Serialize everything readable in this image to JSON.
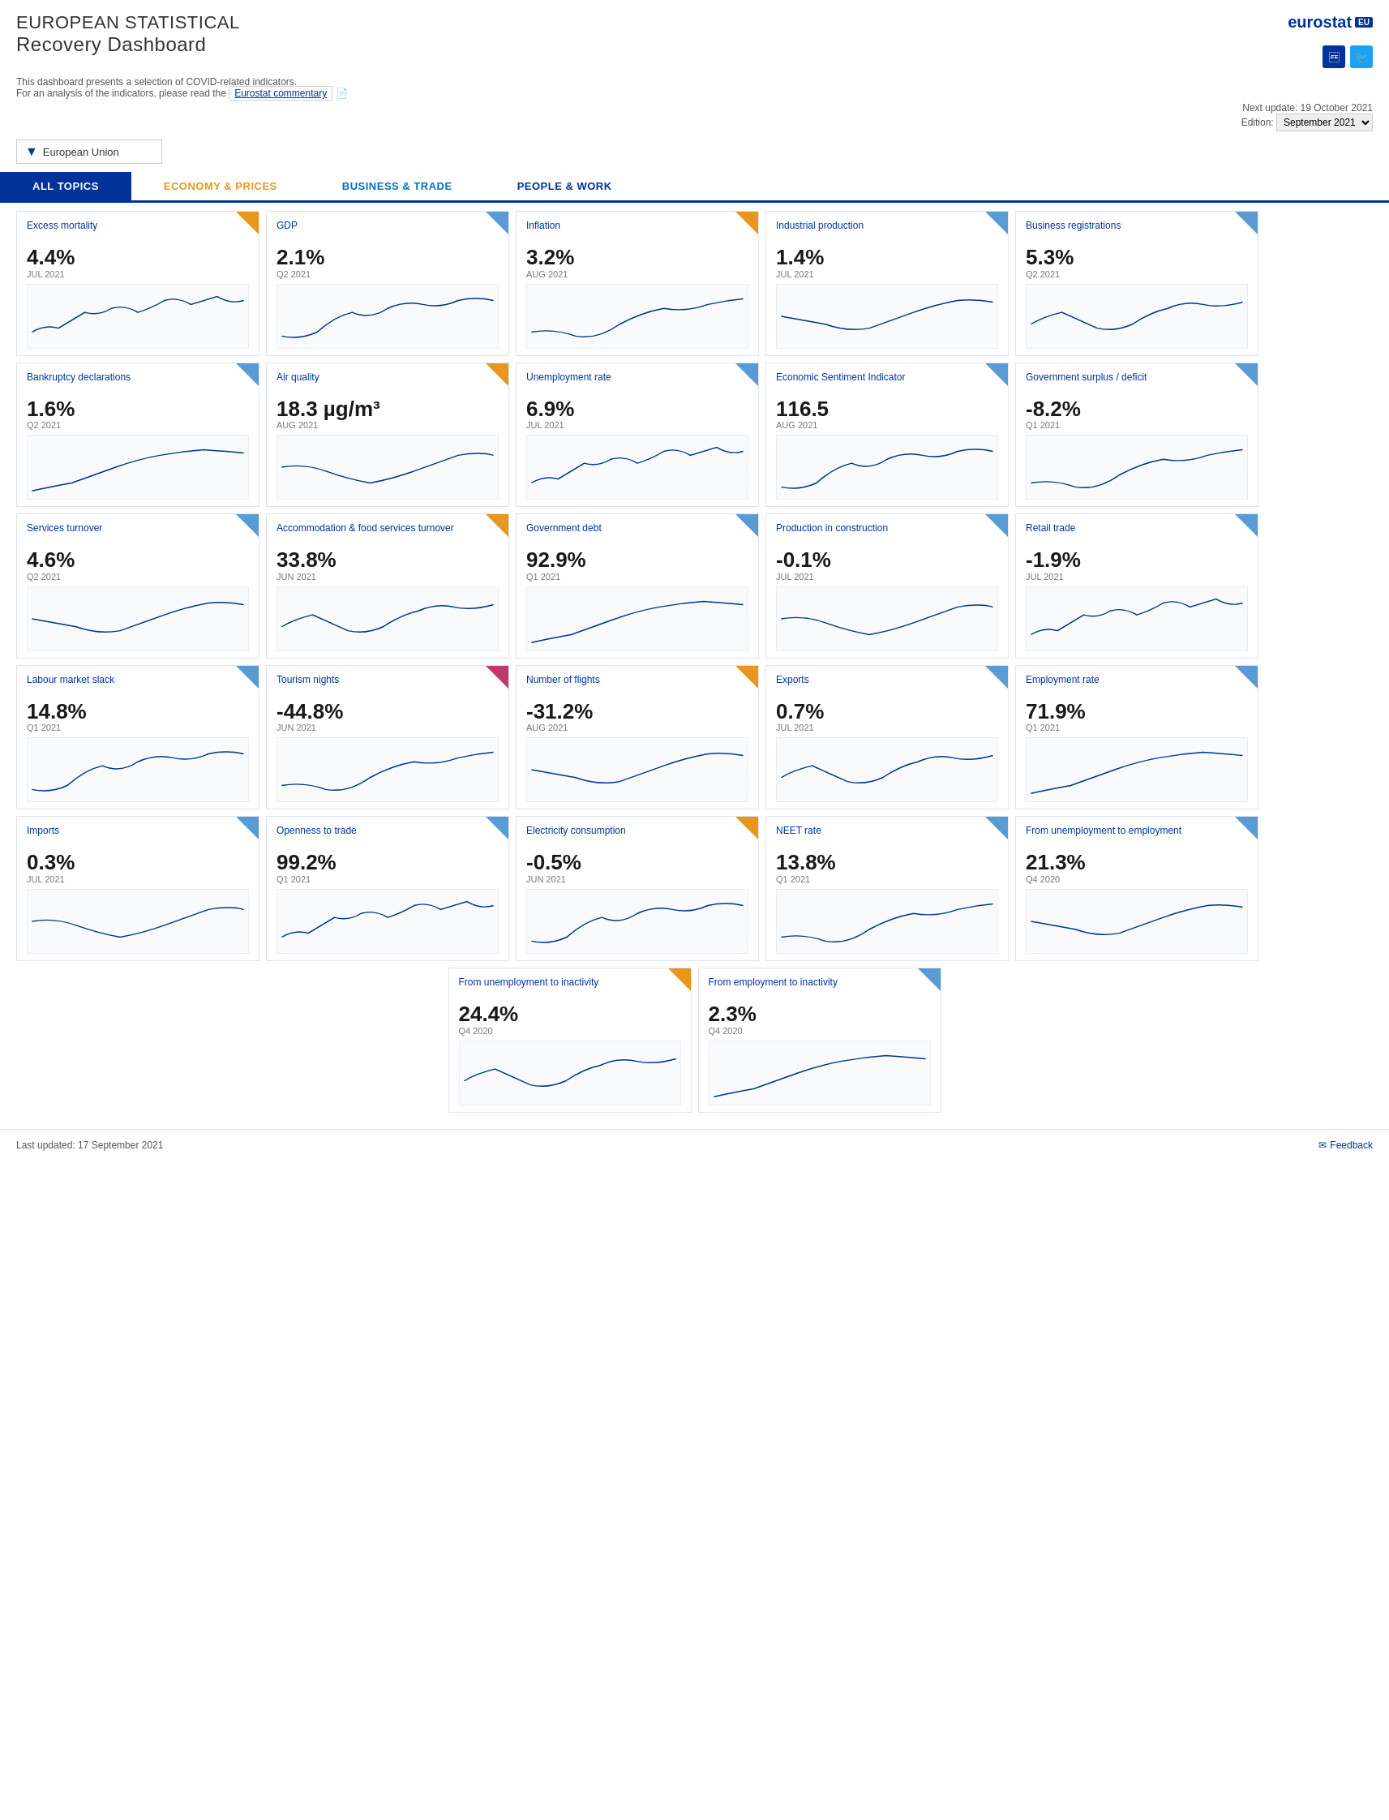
{
  "header": {
    "site_title": "EUROPEAN STATISTICAL",
    "site_subtitle": "Recovery Dashboard",
    "eurostat_label": "eurostat",
    "description_line1": "This dashboard presents a selection of COVID-related indicators.",
    "description_line2": "For an analysis of the indicators, please read the",
    "commentary_link": "Eurostat commentary",
    "next_update_label": "Next update: 19 October 2021",
    "edition_label": "Edition:",
    "edition_value": "September 2021",
    "region_label": "European Union",
    "facebook_icon": "f",
    "twitter_icon": "t"
  },
  "nav": {
    "tabs": [
      {
        "id": "all",
        "label": "ALL TOPICS",
        "active": true
      },
      {
        "id": "economy",
        "label": "ECONOMY & PRICES",
        "active": false
      },
      {
        "id": "business",
        "label": "BUSINESS & TRADE",
        "active": false
      },
      {
        "id": "people",
        "label": "PEOPLE & WORK",
        "active": false
      }
    ]
  },
  "footer": {
    "last_updated": "Last updated: 17 September 2021",
    "feedback": "Feedback"
  },
  "cards": [
    {
      "row": 0,
      "items": [
        {
          "id": "excess-mortality",
          "title": "Excess mortality",
          "value": "4.4%",
          "period": "JUL 2021",
          "corner": "orange",
          "chart_type": "line"
        },
        {
          "id": "gdp",
          "title": "GDP",
          "value": "2.1%",
          "period": "Q2 2021",
          "corner": "blue",
          "chart_type": "line"
        },
        {
          "id": "inflation",
          "title": "Inflation",
          "value": "3.2%",
          "period": "AUG 2021",
          "corner": "orange",
          "chart_type": "line"
        },
        {
          "id": "industrial-production",
          "title": "Industrial production",
          "value": "1.4%",
          "period": "JUL 2021",
          "corner": "blue",
          "chart_type": "line"
        },
        {
          "id": "business-registrations",
          "title": "Business registrations",
          "value": "5.3%",
          "period": "Q2 2021",
          "corner": "blue",
          "chart_type": "line"
        }
      ]
    },
    {
      "row": 1,
      "items": [
        {
          "id": "bankruptcy-declarations",
          "title": "Bankruptcy declarations",
          "value": "1.6%",
          "period": "Q2 2021",
          "corner": "blue",
          "chart_type": "line"
        },
        {
          "id": "air-quality",
          "title": "Air quality",
          "value": "18.3 µg/m³",
          "period": "AUG 2021",
          "corner": "orange",
          "chart_type": "line"
        },
        {
          "id": "unemployment-rate",
          "title": "Unemployment rate",
          "value": "6.9%",
          "period": "JUL 2021",
          "corner": "blue",
          "chart_type": "line"
        },
        {
          "id": "economic-sentiment",
          "title": "Economic Sentiment Indicator",
          "value": "116.5",
          "period": "AUG 2021",
          "corner": "blue",
          "chart_type": "line"
        },
        {
          "id": "government-surplus",
          "title": "Government surplus / deficit",
          "value": "-8.2%",
          "period": "Q1 2021",
          "corner": "blue",
          "chart_type": "line"
        }
      ]
    },
    {
      "row": 2,
      "items": [
        {
          "id": "services-turnover",
          "title": "Services turnover",
          "value": "4.6%",
          "period": "Q2 2021",
          "corner": "blue",
          "chart_type": "line"
        },
        {
          "id": "accommodation-food",
          "title": "Accommodation & food services turnover",
          "value": "33.8%",
          "period": "JUN 2021",
          "corner": "orange",
          "chart_type": "line"
        },
        {
          "id": "government-debt",
          "title": "Government debt",
          "value": "92.9%",
          "period": "Q1 2021",
          "corner": "blue",
          "chart_type": "line"
        },
        {
          "id": "production-construction",
          "title": "Production in construction",
          "value": "-0.1%",
          "period": "JUL 2021",
          "corner": "blue",
          "chart_type": "line"
        },
        {
          "id": "retail-trade",
          "title": "Retail trade",
          "value": "-1.9%",
          "period": "JUL 2021",
          "corner": "blue",
          "chart_type": "line"
        }
      ]
    },
    {
      "row": 3,
      "items": [
        {
          "id": "labour-market-slack",
          "title": "Labour market slack",
          "value": "14.8%",
          "period": "Q1 2021",
          "corner": "blue",
          "chart_type": "line"
        },
        {
          "id": "tourism-nights",
          "title": "Tourism nights",
          "value": "-44.8%",
          "period": "JUN 2021",
          "corner": "pink",
          "chart_type": "line"
        },
        {
          "id": "number-of-flights",
          "title": "Number of flights",
          "value": "-31.2%",
          "period": "AUG 2021",
          "corner": "orange",
          "chart_type": "line"
        },
        {
          "id": "exports",
          "title": "Exports",
          "value": "0.7%",
          "period": "JUL 2021",
          "corner": "blue",
          "chart_type": "line"
        },
        {
          "id": "employment-rate",
          "title": "Employment rate",
          "value": "71.9%",
          "period": "Q1 2021",
          "corner": "blue",
          "chart_type": "line"
        }
      ]
    },
    {
      "row": 4,
      "items": [
        {
          "id": "imports",
          "title": "Imports",
          "value": "0.3%",
          "period": "JUL 2021",
          "corner": "blue",
          "chart_type": "line"
        },
        {
          "id": "openness-to-trade",
          "title": "Openness to trade",
          "value": "99.2%",
          "period": "Q1 2021",
          "corner": "blue",
          "chart_type": "line"
        },
        {
          "id": "electricity-consumption",
          "title": "Electricity consumption",
          "value": "-0.5%",
          "period": "JUN 2021",
          "corner": "orange",
          "chart_type": "line"
        },
        {
          "id": "neet-rate",
          "title": "NEET rate",
          "value": "13.8%",
          "period": "Q1 2021",
          "corner": "blue",
          "chart_type": "line"
        },
        {
          "id": "unemployment-to-employment",
          "title": "From unemployment to employment",
          "value": "21.3%",
          "period": "Q4 2020",
          "corner": "blue",
          "chart_type": "line"
        }
      ]
    },
    {
      "row": 5,
      "centered": true,
      "items": [
        {
          "id": "unemployment-to-inactivity",
          "title": "From unemployment to inactivity",
          "value": "24.4%",
          "period": "Q4 2020",
          "corner": "orange",
          "chart_type": "line"
        },
        {
          "id": "employment-to-inactivity",
          "title": "From employment to inactivity",
          "value": "2.3%",
          "period": "Q4 2020",
          "corner": "blue",
          "chart_type": "line"
        }
      ]
    }
  ]
}
